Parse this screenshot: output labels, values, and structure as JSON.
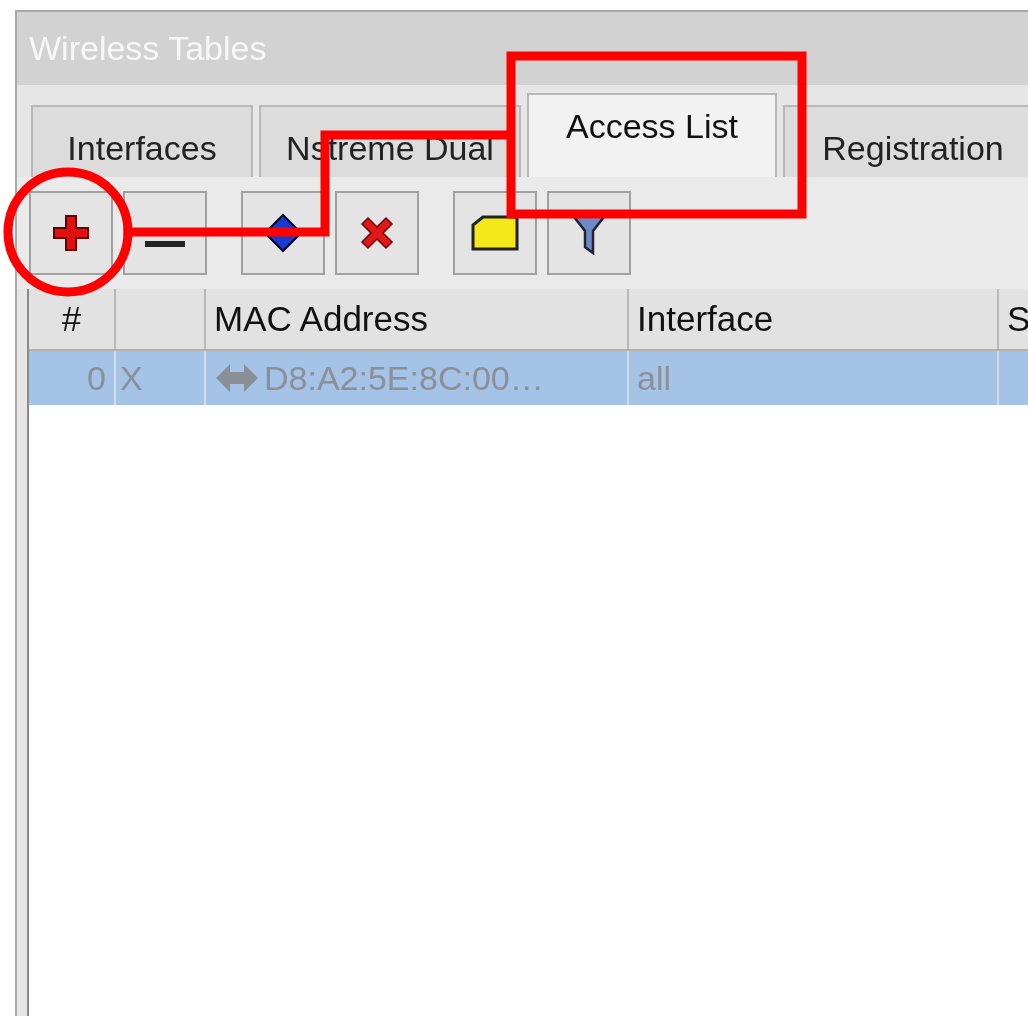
{
  "window": {
    "title": "Wireless Tables"
  },
  "tabs": [
    {
      "label": "Interfaces",
      "selected": false
    },
    {
      "label": "Nstreme Dual",
      "selected": false
    },
    {
      "label": "Access List",
      "selected": true
    },
    {
      "label": "Registration",
      "selected": false
    }
  ],
  "toolbar": [
    {
      "kind": "add"
    },
    {
      "kind": "remove"
    },
    {
      "kind": "enable"
    },
    {
      "kind": "disable"
    },
    {
      "kind": "comment"
    },
    {
      "kind": "filter"
    }
  ],
  "table": {
    "columns": [
      "#",
      "MAC Address",
      "Interface",
      "S"
    ],
    "rows": [
      {
        "number": "0",
        "flag": "X",
        "mac_address": "D8:A2:5E:8C:00…",
        "interface": "all",
        "selected": true,
        "disabled": true
      }
    ]
  },
  "annotations": [
    {
      "kind": "circle"
    },
    {
      "kind": "rectangle"
    },
    {
      "kind": "connector"
    }
  ]
}
